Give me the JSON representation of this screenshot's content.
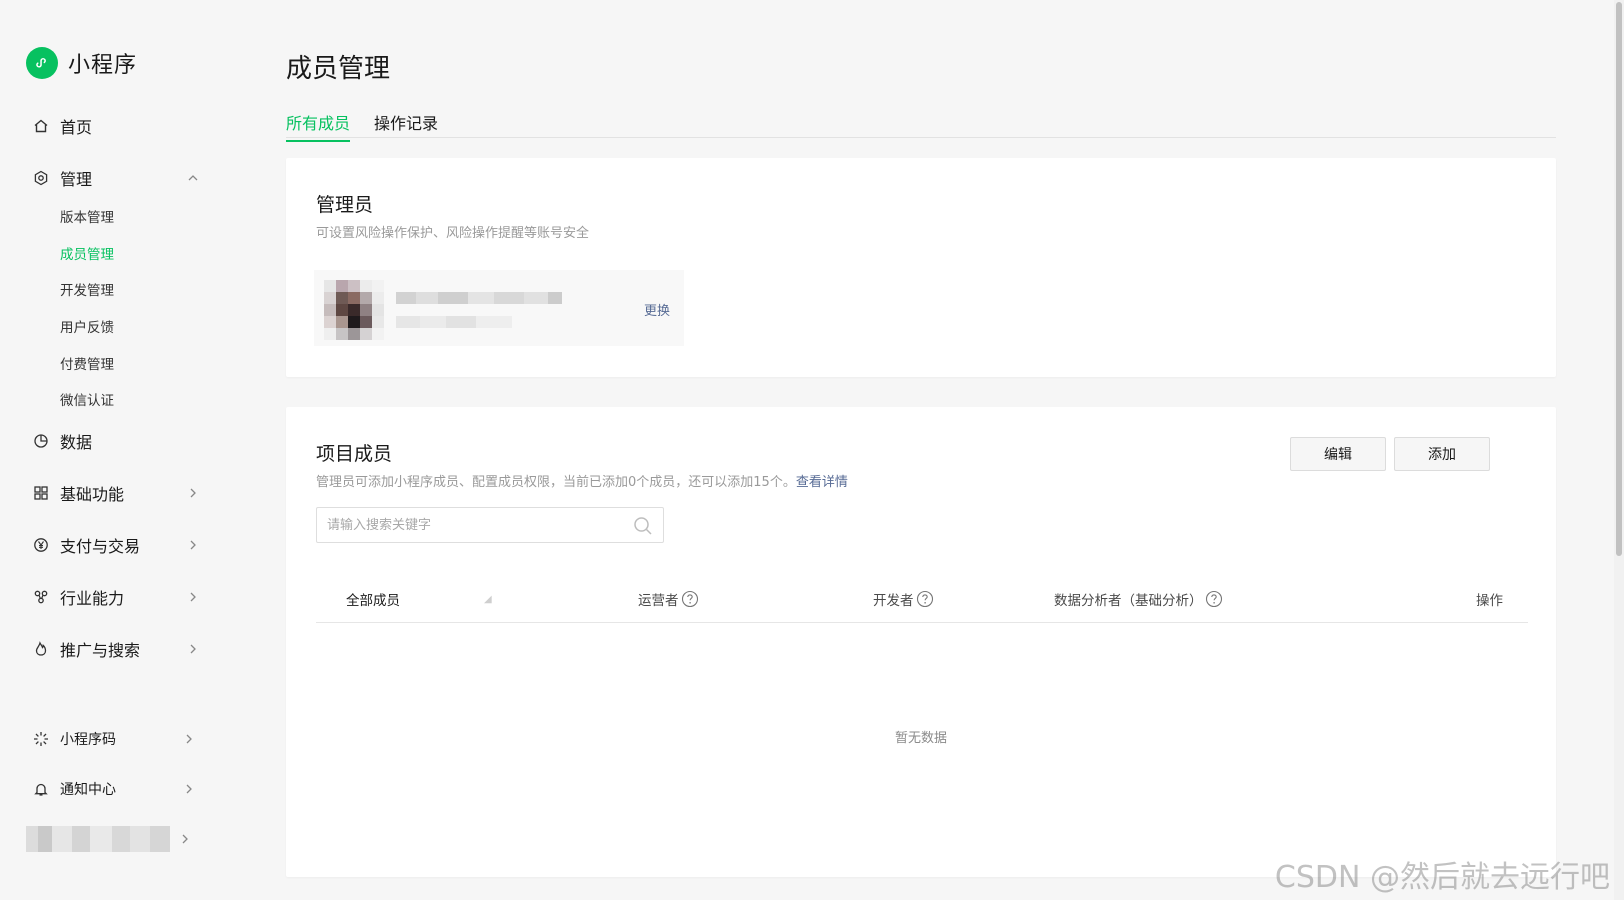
{
  "brand": {
    "name": "小程序"
  },
  "sidebar": {
    "items": [
      {
        "label": "首页",
        "icon": "home-icon"
      },
      {
        "label": "管理",
        "icon": "gear-icon",
        "expanded": true
      },
      {
        "label": "数据",
        "icon": "pie-chart-icon"
      },
      {
        "label": "基础功能",
        "icon": "grid-icon"
      },
      {
        "label": "支付与交易",
        "icon": "yen-icon"
      },
      {
        "label": "行业能力",
        "icon": "nodes-icon"
      },
      {
        "label": "推广与搜索",
        "icon": "flame-icon"
      },
      {
        "label": "小程序码",
        "icon": "sparkle-icon"
      },
      {
        "label": "通知中心",
        "icon": "bell-icon"
      }
    ],
    "sub_items": [
      {
        "label": "版本管理"
      },
      {
        "label": "成员管理",
        "active": true
      },
      {
        "label": "开发管理"
      },
      {
        "label": "用户反馈"
      },
      {
        "label": "付费管理"
      },
      {
        "label": "微信认证"
      }
    ]
  },
  "page": {
    "title": "成员管理",
    "tabs": [
      {
        "label": "所有成员",
        "active": true
      },
      {
        "label": "操作记录"
      }
    ]
  },
  "admin_card": {
    "title": "管理员",
    "desc": "可设置风险操作保护、风险操作提醒等账号安全",
    "change_label": "更换"
  },
  "members_card": {
    "title": "项目成员",
    "desc": "管理员可添加小程序成员、配置成员权限，当前已添加0个成员，还可以添加15个。",
    "detail_link": "查看详情",
    "edit_label": "编辑",
    "add_label": "添加",
    "search_placeholder": "请输入搜索关键字",
    "columns": [
      "全部成员",
      "运营者",
      "开发者",
      "数据分析者（基础分析）",
      "操作"
    ],
    "empty_text": "暂无数据"
  },
  "watermark": "CSDN @然后就去远行吧",
  "colors": {
    "accent": "#07c160",
    "link": "#576b95"
  }
}
